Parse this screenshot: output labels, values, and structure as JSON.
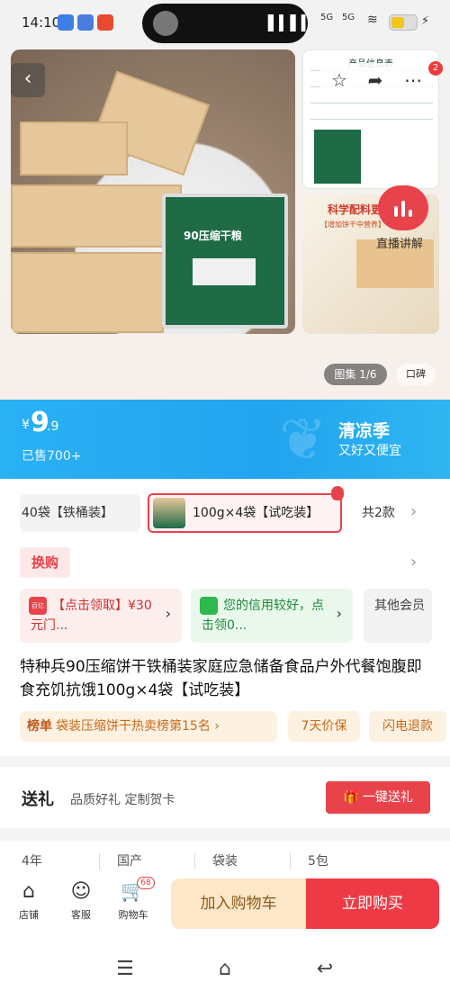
{
  "status_bar": {
    "time": "14:10",
    "signal_1": "5G",
    "signal_2": "5G",
    "battery_percent": 40
  },
  "gallery": {
    "back_icon": "chevron-left-icon",
    "main_pack_label": "90压缩干粮",
    "info_card_title": "产品信息表",
    "science_card_title": "科学配料更健康",
    "science_card_subtitle": "【增加饼干中营养】",
    "live_label": "直播讲解",
    "album_label": "图集 1/6",
    "album_secondary": "口碑",
    "more_badge": "2"
  },
  "price_banner": {
    "currency_symbol": "¥",
    "price_int": "9",
    "price_dec": ".9",
    "sold_text": "已售700+",
    "season_title": "清凉季",
    "season_subtitle": "又好又便宜",
    "accent": "#22a4ef"
  },
  "sku": {
    "option_1": "40袋【铁桶装】",
    "option_2": "100g×4袋【试吃装】",
    "count_text": "共2款"
  },
  "exchange": {
    "label": "换购"
  },
  "coupons": {
    "c1_icon_text": "百亿",
    "c1_text": "【点击领取】¥30元门...",
    "c2_text": "您的信用较好，点击领0...",
    "c3_text": "其他会员"
  },
  "product": {
    "title": "特种兵90压缩饼干铁桶装家庭应急储备食品户外代餐饱腹即食充饥抗饿100g×4袋【试吃装】"
  },
  "tags": {
    "rank_label": "榜单",
    "rank_text": "袋装压缩饼干热卖榜第15名",
    "seven_day": "7天价保",
    "fast_refund": "闪电退款"
  },
  "gift": {
    "title": "送礼",
    "subtitle": "品质好礼 定制贺卡",
    "button": "一键送礼"
  },
  "specs": [
    "4年",
    "国产",
    "袋装",
    "5包"
  ],
  "actions": {
    "store": "店铺",
    "service": "客服",
    "cart": "购物车",
    "cart_count": "68",
    "add_to_cart": "加入购物车",
    "buy_now": "立即购买",
    "buy_color": "#ee3a44"
  }
}
